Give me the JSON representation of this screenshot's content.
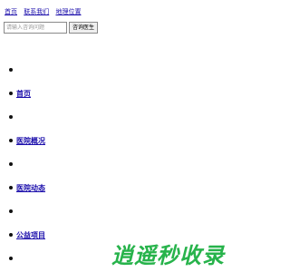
{
  "top_links": [
    "首页",
    "联系我们",
    "地理位置"
  ],
  "search": {
    "placeholder": "请输入咨询问题",
    "button_label": "咨询医生"
  },
  "nav": {
    "items": [
      {
        "label": ""
      },
      {
        "label": "首页"
      },
      {
        "label": ""
      },
      {
        "label": "医院概况"
      },
      {
        "label": ""
      },
      {
        "label": "医院动态"
      },
      {
        "label": ""
      },
      {
        "label": "公益项目"
      },
      {
        "label": ""
      }
    ]
  },
  "watermark": {
    "text": "逍遥秒收录",
    "color": "#27b34b"
  }
}
